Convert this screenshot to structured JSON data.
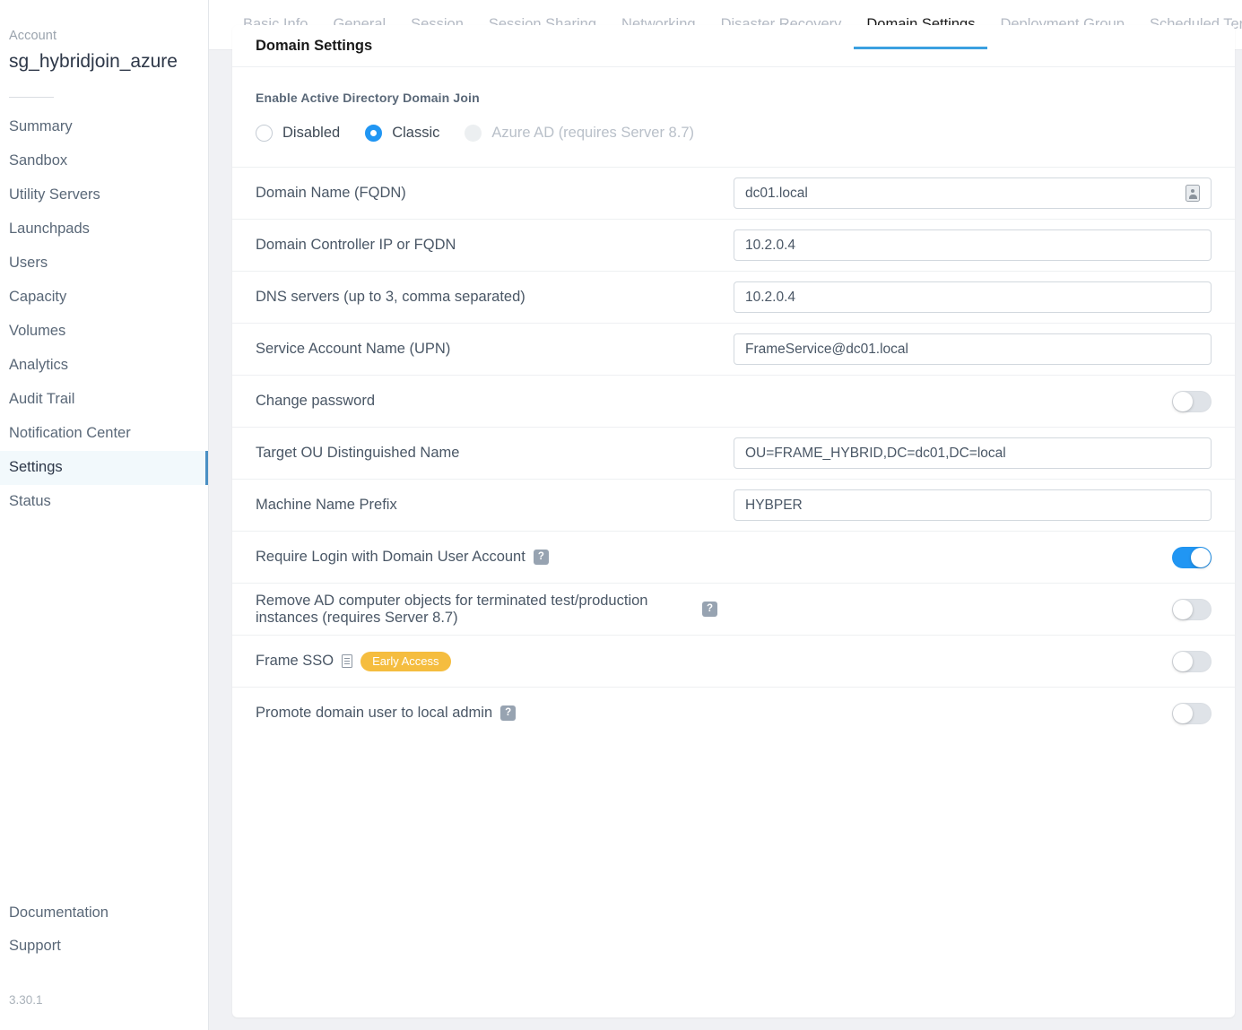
{
  "sidebar": {
    "account_label": "Account",
    "account_name": "sg_hybridjoin_azure",
    "items": [
      {
        "label": "Summary",
        "active": false
      },
      {
        "label": "Sandbox",
        "active": false
      },
      {
        "label": "Utility Servers",
        "active": false
      },
      {
        "label": "Launchpads",
        "active": false
      },
      {
        "label": "Users",
        "active": false
      },
      {
        "label": "Capacity",
        "active": false
      },
      {
        "label": "Volumes",
        "active": false
      },
      {
        "label": "Analytics",
        "active": false
      },
      {
        "label": "Audit Trail",
        "active": false
      },
      {
        "label": "Notification Center",
        "active": false
      },
      {
        "label": "Settings",
        "active": true
      },
      {
        "label": "Status",
        "active": false
      }
    ],
    "footer_items": [
      {
        "label": "Documentation"
      },
      {
        "label": "Support"
      }
    ],
    "version": "3.30.1"
  },
  "tabs": [
    {
      "label": "Basic Info",
      "active": false
    },
    {
      "label": "General",
      "active": false
    },
    {
      "label": "Session",
      "active": false
    },
    {
      "label": "Session Sharing",
      "active": false
    },
    {
      "label": "Networking",
      "active": false
    },
    {
      "label": "Disaster Recovery",
      "active": false
    },
    {
      "label": "Domain Settings",
      "active": true
    },
    {
      "label": "Deployment Group",
      "active": false
    },
    {
      "label": "Scheduled Terminatio",
      "active": false
    }
  ],
  "card": {
    "title": "Domain Settings",
    "ad_section_title": "Enable Active Directory Domain Join",
    "radio_options": [
      {
        "label": "Disabled",
        "state": "unchecked"
      },
      {
        "label": "Classic",
        "state": "checked"
      },
      {
        "label": "Azure AD (requires Server 8.7)",
        "state": "disabled"
      }
    ],
    "rows": [
      {
        "label": "Domain Name (FQDN)",
        "control": "text",
        "value": "dc01.local",
        "autofill_icon": true
      },
      {
        "label": "Domain Controller IP or FQDN",
        "control": "text",
        "value": "10.2.0.4",
        "autofill_icon": false
      },
      {
        "label": "DNS servers (up to 3, comma separated)",
        "control": "text",
        "value": "10.2.0.4",
        "autofill_icon": false
      },
      {
        "label": "Service Account Name (UPN)",
        "control": "text",
        "value": "FrameService@dc01.local",
        "autofill_icon": false
      },
      {
        "label": "Change password",
        "control": "toggle",
        "toggle_on": false
      },
      {
        "label": "Target OU Distinguished Name",
        "control": "text",
        "value": "OU=FRAME_HYBRID,DC=dc01,DC=local",
        "autofill_icon": false
      },
      {
        "label": "Machine Name Prefix",
        "control": "text",
        "value": "HYBPER",
        "autofill_icon": false
      },
      {
        "label": "Require Login with Domain User Account",
        "control": "toggle",
        "toggle_on": true,
        "help": "?"
      },
      {
        "label": "Remove AD computer objects for terminated test/production instances (requires Server 8.7)",
        "control": "toggle",
        "toggle_on": false,
        "help": "?"
      },
      {
        "label": "Frame SSO",
        "control": "toggle",
        "toggle_on": false,
        "doc": true,
        "badge": "Early Access"
      },
      {
        "label": "Promote domain user to local admin",
        "control": "toggle",
        "toggle_on": false,
        "help": "?"
      }
    ]
  },
  "colors": {
    "accent_blue": "#2196f3",
    "tab_underline": "#3ba0e0",
    "badge_amber": "#f5bd3f",
    "sidebar_active_bg": "#f2f9fc"
  }
}
